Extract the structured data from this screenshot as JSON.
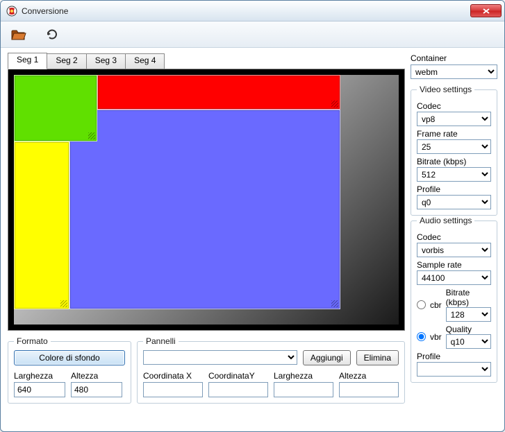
{
  "window": {
    "title": "Conversione"
  },
  "tabs": [
    "Seg 1",
    "Seg 2",
    "Seg 3",
    "Seg 4"
  ],
  "activeTab": 0,
  "canvas": {
    "panels": [
      {
        "name": "green",
        "color": "#60e000"
      },
      {
        "name": "red",
        "color": "#ff0000"
      },
      {
        "name": "yellow",
        "color": "#ffff00"
      },
      {
        "name": "blue",
        "color": "#6a6aff"
      }
    ]
  },
  "formato": {
    "legend": "Formato",
    "bg_button": "Colore di sfondo",
    "larghezza_label": "Larghezza",
    "altezza_label": "Altezza",
    "larghezza": "640",
    "altezza": "480"
  },
  "pannelli": {
    "legend": "Pannelli",
    "selected": "",
    "aggiungi": "Aggiungi",
    "elimina": "Elimina",
    "coordX_label": "Coordinata X",
    "coordY_label": "CoordinataY",
    "larghezza_label": "Larghezza",
    "altezza_label": "Altezza",
    "coordX": "",
    "coordY": "",
    "larghezza": "",
    "altezza": ""
  },
  "right": {
    "container_label": "Container",
    "container": "webm",
    "video_legend": "Video settings",
    "video_codec_label": "Codec",
    "video_codec": "vp8",
    "framerate_label": "Frame rate",
    "framerate": "25",
    "vbitrate_label": "Bitrate (kbps)",
    "vbitrate": "512",
    "vprofile_label": "Profile",
    "vprofile": "q0",
    "audio_legend": "Audio settings",
    "audio_codec_label": "Codec",
    "audio_codec": "vorbis",
    "sample_label": "Sample rate",
    "sample": "44100",
    "cbr_label": "cbr",
    "vbr_label": "vbr",
    "abitrate_label": "Bitrate (kbps)",
    "abitrate": "128",
    "quality_label": "Quality",
    "quality": "q10",
    "aprofile_label": "Profile",
    "mode": "vbr"
  }
}
